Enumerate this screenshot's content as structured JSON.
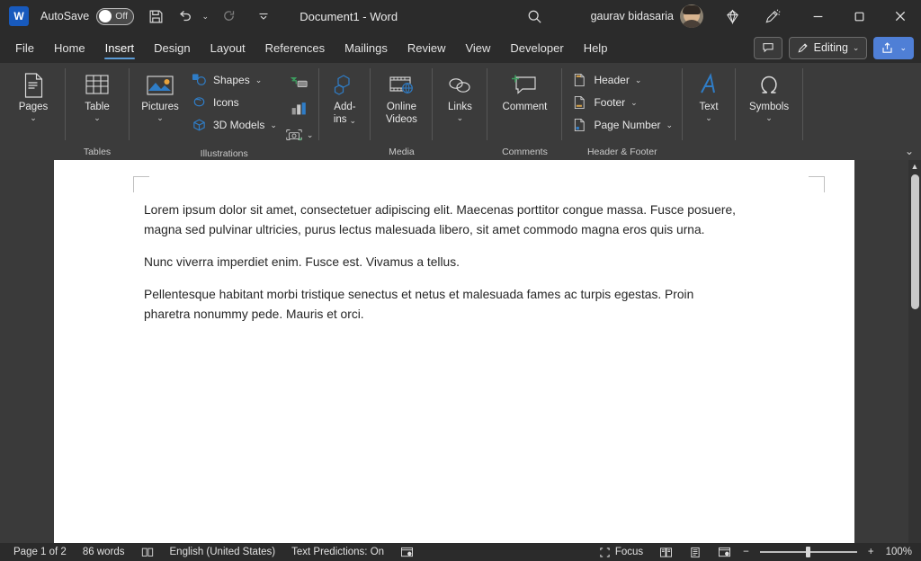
{
  "titlebar": {
    "app_logo": "word-logo",
    "autosave_label": "AutoSave",
    "autosave_state": "Off",
    "save_icon": "save-icon",
    "undo_icon": "undo-icon",
    "redo_icon": "redo-icon",
    "customize_icon": "customize-quick-access-icon",
    "document_title": "Document1  -  Word",
    "search_icon": "search-icon",
    "user_name": "gaurav bidasaria",
    "avatar": "user-avatar",
    "diamond_icon": "microsoft-365-diamond-icon",
    "pen_icon": "designer-pen-icon",
    "minimize": "minimize-icon",
    "maximize": "maximize-icon",
    "close": "close-icon"
  },
  "tabs": [
    {
      "label": "File",
      "active": false
    },
    {
      "label": "Home",
      "active": false
    },
    {
      "label": "Insert",
      "active": true
    },
    {
      "label": "Design",
      "active": false
    },
    {
      "label": "Layout",
      "active": false
    },
    {
      "label": "References",
      "active": false
    },
    {
      "label": "Mailings",
      "active": false
    },
    {
      "label": "Review",
      "active": false
    },
    {
      "label": "View",
      "active": false
    },
    {
      "label": "Developer",
      "active": false
    },
    {
      "label": "Help",
      "active": false
    }
  ],
  "tabrow_right": {
    "comments_icon": "comments-icon",
    "editing_label": "Editing",
    "editing_icon": "pencil-icon",
    "editing_caret": "⌄",
    "share_icon": "share-icon",
    "share_caret": "⌄"
  },
  "ribbon": {
    "collapse_icon": "collapse-ribbon-chevron-icon",
    "groups": [
      {
        "name": "",
        "items": [
          {
            "label": "Pages",
            "icon": "pages-icon",
            "caret": "⌄"
          }
        ]
      },
      {
        "name": "Tables",
        "items": [
          {
            "label": "Table",
            "icon": "table-icon",
            "caret": "⌄"
          }
        ]
      },
      {
        "name": "Illustrations",
        "items": [
          {
            "label": "Pictures",
            "icon": "pictures-icon",
            "caret": "⌄"
          },
          {
            "label": "Shapes",
            "icon": "shapes-icon",
            "caret": "⌄"
          },
          {
            "label": "Icons",
            "icon": "icons-icon",
            "caret": ""
          },
          {
            "label": "3D Models",
            "icon": "3d-models-icon",
            "caret": "⌄"
          },
          {
            "label": "",
            "icon": "smartart-icon",
            "caret": ""
          },
          {
            "label": "",
            "icon": "chart-icon",
            "caret": ""
          },
          {
            "label": "",
            "icon": "screenshot-icon",
            "caret": "⌄"
          }
        ]
      },
      {
        "name": "",
        "items": [
          {
            "label": "Add-ins",
            "icon": "addins-icon",
            "caret": "⌄"
          }
        ]
      },
      {
        "name": "Media",
        "items": [
          {
            "label": "Online Videos",
            "icon": "online-video-icon",
            "caret": ""
          }
        ]
      },
      {
        "name": "",
        "items": [
          {
            "label": "Links",
            "icon": "links-icon",
            "caret": "⌄"
          }
        ]
      },
      {
        "name": "Comments",
        "items": [
          {
            "label": "Comment",
            "icon": "new-comment-icon",
            "caret": ""
          }
        ]
      },
      {
        "name": "Header & Footer",
        "items": [
          {
            "label": "Header",
            "icon": "header-icon",
            "caret": "⌄"
          },
          {
            "label": "Footer",
            "icon": "footer-icon",
            "caret": "⌄"
          },
          {
            "label": "Page Number",
            "icon": "page-number-icon",
            "caret": "⌄"
          }
        ]
      },
      {
        "name": "",
        "items": [
          {
            "label": "Text",
            "icon": "text-icon",
            "caret": "⌄"
          }
        ]
      },
      {
        "name": "",
        "items": [
          {
            "label": "Symbols",
            "icon": "symbols-omega-icon",
            "caret": "⌄"
          }
        ]
      }
    ],
    "labels": {
      "pages": "Pages",
      "table": "Table",
      "pictures": "Pictures",
      "shapes": "Shapes",
      "icons": "Icons",
      "models3d": "3D Models",
      "addins_line1": "Add-",
      "addins_line2": "ins",
      "online_line1": "Online",
      "online_line2": "Videos",
      "links": "Links",
      "comment": "Comment",
      "header": "Header",
      "footer": "Footer",
      "page_number": "Page Number",
      "text": "Text",
      "symbols": "Symbols",
      "group_tables": "Tables",
      "group_illustrations": "Illustrations",
      "group_media": "Media",
      "group_comments": "Comments",
      "group_header_footer": "Header & Footer",
      "caret": "⌄"
    }
  },
  "document": {
    "paragraphs": [
      "Lorem ipsum dolor sit amet, consectetuer adipiscing elit. Maecenas porttitor congue massa. Fusce posuere, magna sed pulvinar ultricies, purus lectus malesuada libero, sit amet commodo magna eros quis urna.",
      "Nunc viverra imperdiet enim. Fusce est. Vivamus a tellus.",
      "Pellentesque habitant morbi tristique senectus et netus et malesuada fames ac turpis egestas. Proin pharetra nonummy pede. Mauris et orci."
    ],
    "scrollbar_up_arrow": "▲"
  },
  "statusbar": {
    "page_info": "Page 1 of 2",
    "word_count": "86 words",
    "proofing_icon": "proofing-icon",
    "language": "English (United States)",
    "text_predictions": "Text Predictions: On",
    "accessibility_icon": "accessibility-icon",
    "focus_label": "Focus",
    "focus_icon": "focus-icon",
    "read_mode_icon": "read-mode-icon",
    "print_layout_icon": "print-layout-icon",
    "web_layout_icon": "web-layout-icon",
    "zoom_out": "−",
    "zoom_in": "+",
    "zoom_level": "100%"
  },
  "colors": {
    "titlebar_bg": "#2b2b2b",
    "ribbon_bg": "#3b3b3b",
    "doc_bg": "#3a3a3a",
    "page_bg": "#ffffff",
    "accent_blue": "#5b9bd5",
    "share_blue": "#4f7fd6",
    "word_blue": "#185abd"
  }
}
